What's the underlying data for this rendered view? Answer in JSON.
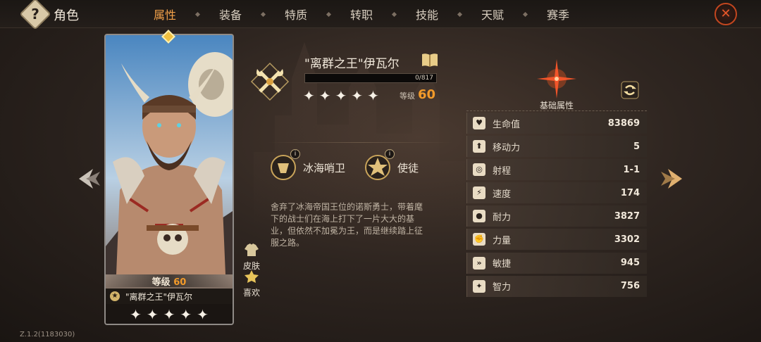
{
  "header": {
    "title": "角色",
    "help_glyph": "?",
    "tabs": [
      {
        "label": "属性",
        "active": true
      },
      {
        "label": "装备",
        "active": false
      },
      {
        "label": "特质",
        "active": false
      },
      {
        "label": "转职",
        "active": false
      },
      {
        "label": "技能",
        "active": false
      },
      {
        "label": "天赋",
        "active": false
      },
      {
        "label": "赛季",
        "active": false
      }
    ],
    "close_glyph": "✕"
  },
  "card": {
    "level_label": "等级",
    "level_value": "60",
    "name": "\"离群之王\"伊瓦尔",
    "badge_glyph": "★",
    "stars": [
      "✦",
      "✦",
      "✦",
      "✦",
      "✦"
    ]
  },
  "side_buttons": {
    "skin_label": "皮肤",
    "favorite_label": "喜欢"
  },
  "hero": {
    "title": "\"离群之王\"伊瓦尔",
    "exp_text": "0/817",
    "exp_progress": 0,
    "stars": [
      "✦",
      "✦",
      "✦",
      "✦",
      "✦"
    ],
    "level_label": "等级",
    "level_value": "60",
    "traits": [
      {
        "label": "冰海哨卫",
        "info": "i"
      },
      {
        "label": "使徒",
        "info": "i"
      }
    ],
    "description": "舍弃了冰海帝国王位的诺斯勇士，带着麾下的战士们在海上打下了一片大大的基业，但依然不加冕为王，而是继续踏上征服之路。"
  },
  "stats": {
    "title": "基础属性",
    "rows": [
      {
        "name": "生命值",
        "value": "83869",
        "icon": "heart-icon",
        "glyph": "♥"
      },
      {
        "name": "移动力",
        "value": "5",
        "icon": "boot-icon",
        "glyph": "⬆"
      },
      {
        "name": "射程",
        "value": "1-1",
        "icon": "target-icon",
        "glyph": "◎"
      },
      {
        "name": "速度",
        "value": "174",
        "icon": "speed-icon",
        "glyph": "⚡"
      },
      {
        "name": "耐力",
        "value": "3827",
        "icon": "endurance-icon",
        "glyph": "●"
      },
      {
        "name": "力量",
        "value": "3302",
        "icon": "strength-icon",
        "glyph": "✊"
      },
      {
        "name": "敏捷",
        "value": "945",
        "icon": "agility-icon",
        "glyph": "»"
      },
      {
        "name": "智力",
        "value": "756",
        "icon": "intellect-icon",
        "glyph": "✦"
      }
    ]
  },
  "version": "Z.1.2(1183030)",
  "colors": {
    "accent": "#f29a2a",
    "active_tab": "#f4a24a",
    "close": "#e8572a"
  }
}
